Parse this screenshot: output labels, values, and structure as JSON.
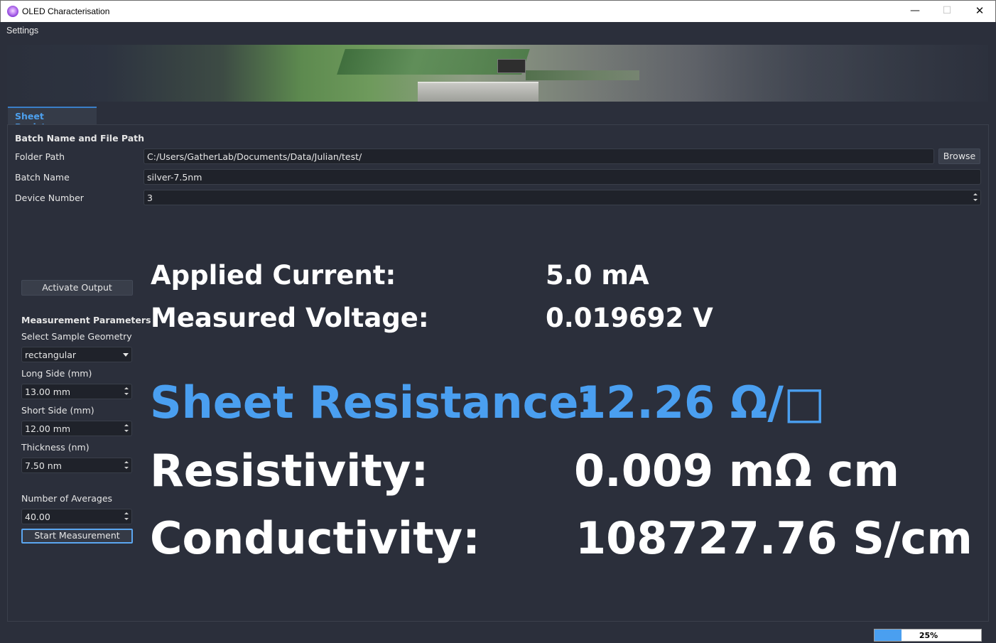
{
  "window": {
    "title": "OLED Characterisation",
    "minimize": "—",
    "maximize": "☐",
    "close": "✕"
  },
  "menu": {
    "settings": "Settings"
  },
  "tabs": [
    {
      "label": "Sheet Resistance",
      "active": true
    }
  ],
  "file_section": {
    "heading": "Batch Name and File Path",
    "folder_label": "Folder Path",
    "folder_value": "C:/Users/GatherLab/Documents/Data/Julian/test/",
    "browse_label": "Browse",
    "batch_label": "Batch Name",
    "batch_value": "silver-7.5nm",
    "device_label": "Device Number",
    "device_value": "3"
  },
  "controls": {
    "activate_output": "Activate Output",
    "params_heading": "Measurement Parameters",
    "geometry_label": "Select Sample Geometry",
    "geometry_value": "rectangular",
    "long_side_label": "Long Side (mm)",
    "long_side_value": "13.00 mm",
    "short_side_label": "Short Side (mm)",
    "short_side_value": "12.00 mm",
    "thickness_label": "Thickness (nm)",
    "thickness_value": "7.50 nm",
    "averages_label": "Number of Averages",
    "averages_value": "40.00",
    "start_measurement": "Start Measurement"
  },
  "readout": {
    "applied_current_label": "Applied Current:",
    "applied_current_value": "5.0 mA",
    "measured_voltage_label": "Measured Voltage:",
    "measured_voltage_value": "0.019692 V",
    "sheet_resistance_label": "Sheet Resistance:",
    "sheet_resistance_value": "12.26 Ω/□",
    "resistivity_label": "Resistivity:",
    "resistivity_value": "0.009 mΩ cm",
    "conductivity_label": "Conductivity:",
    "conductivity_value": "108727.76 S/cm"
  },
  "status": {
    "progress_percent": 25,
    "progress_text": "25%"
  },
  "colors": {
    "accent": "#4a9ff0",
    "background": "#2b2f3b",
    "field": "#1f222a"
  }
}
